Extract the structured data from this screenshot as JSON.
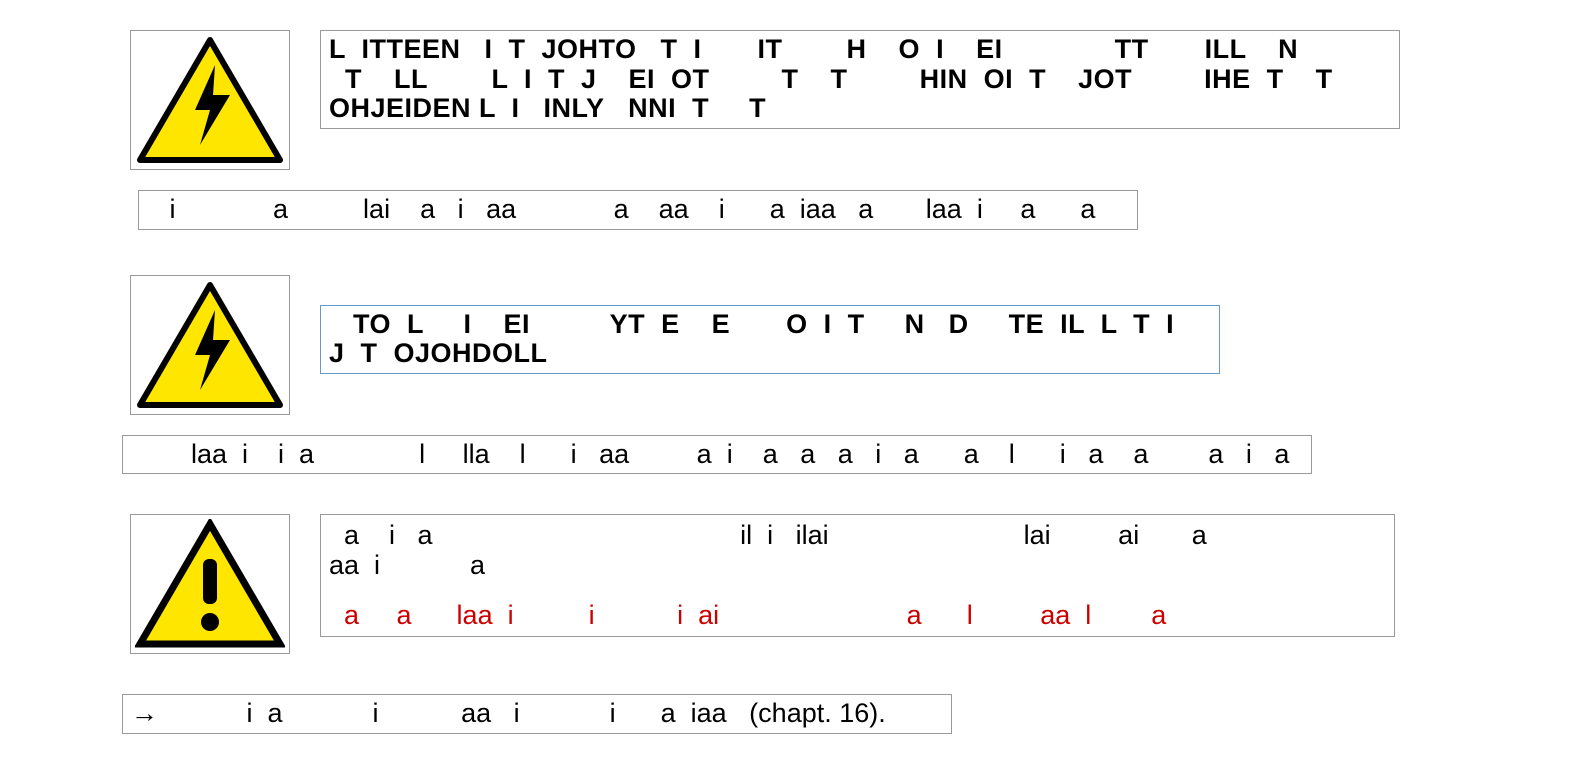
{
  "block1": {
    "text": "L  ITTEEN   I  T  JOHTO   T  I       IT        H    O  I    EI              TT       ILL    N\n  T    LL        L  I  T  J    EI  OT         T    T         HIN  OI  T    JOT         IHE  T    T\nOHJEIDEN L  I   INLY   NNI  T     T"
  },
  "block2": {
    "text": "   i             a          lai    a   i   aa             a    aa    i      a  iaa   a       laa  i     a      a"
  },
  "block3": {
    "text": "   TO  L     I    EI          YT  E    E       O  I  T     N   D     TE  IL  L  T  I\nJ  T  OJOHDOLL"
  },
  "block4": {
    "text": "        laa  i    i  a              l     lla    l      i   aa         a  i    a   a   a   i   a      a    l      i   a    a        a   i   a"
  },
  "block5": {
    "black": "  a    i   a                                         il  i   ilai                          lai         ai       a\naa  i            a",
    "red": "  a     a      laa  i          i           i  ai                         a      l         aa  l        a"
  },
  "block6": {
    "arrow": "→",
    "text": "           i  a            i           aa   i            i      a  iaa   (chapt. 16)."
  }
}
